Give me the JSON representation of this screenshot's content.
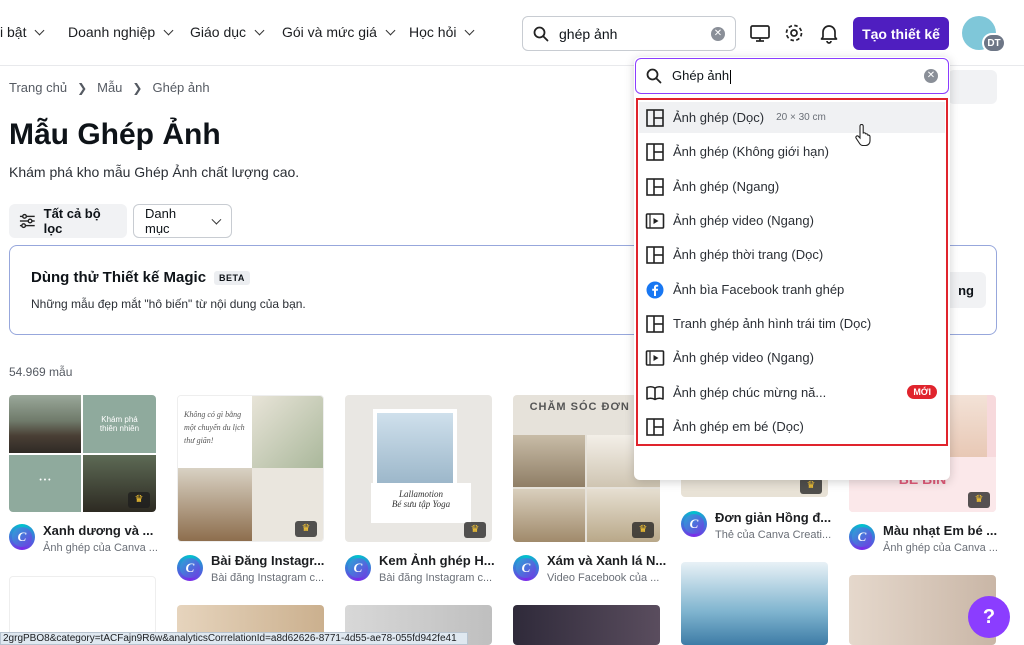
{
  "nav": {
    "items": [
      "i bật",
      "Doanh nghiệp",
      "Giáo dục",
      "Gói và mức giá",
      "Học hỏi"
    ],
    "search_value": "ghép ảnh",
    "create_label": "Tạo thiết kế",
    "avatar_initials": "DT"
  },
  "breadcrumb": [
    "Trang chủ",
    "Mẫu",
    "Ghép ảnh"
  ],
  "header": {
    "title": "Mẫu Ghép Ảnh",
    "subtitle": "Khám phá kho mẫu Ghép Ảnh chất lượng cao."
  },
  "filters": {
    "all_label": "Tất cả bộ lọc",
    "category_label": "Danh mục"
  },
  "magic": {
    "title": "Dùng thử Thiết kế Magic",
    "badge": "BETA",
    "desc": "Những mẫu đẹp mắt \"hô biến\" từ nội dung của bạn.",
    "button_partial": "ng"
  },
  "count": "54.969 mẫu",
  "cards": [
    {
      "title": "Xanh dương và ...",
      "sub": "Ảnh ghép của Canva ..."
    },
    {
      "title": "Bài Đăng Instagr...",
      "sub": "Bài đăng Instagram c..."
    },
    {
      "title": "Kem Ảnh ghép H...",
      "sub": "Bài đăng Instagram c..."
    },
    {
      "title": "Xám và Xanh lá N...",
      "sub": "Video Facebook của ..."
    },
    {
      "title": "Đơn giản Hồng đ...",
      "sub": "Thẻ của Canva Creati..."
    },
    {
      "title": "Màu nhạt Em bé ...",
      "sub": "Ảnh ghép của Canva ..."
    }
  ],
  "thumb_text": {
    "t1a": "Khám phá",
    "t1b": "thiên nhiên",
    "t2": "Không có gì bằng một chuyến du lịch thư giãn!",
    "t3a": "Lallamotion",
    "t3b": "Bé sưu tập Yoga",
    "t4": "CHĂM SÓC ĐƠN G",
    "t6": "BÉ BIN"
  },
  "dropdown": {
    "query": "Ghép ảnh",
    "items": [
      {
        "label": "Ảnh ghép (Dọc)",
        "meta": "20 × 30 cm",
        "icon": "layout-icon"
      },
      {
        "label": "Ảnh ghép (Không giới hạn)",
        "icon": "layout-icon"
      },
      {
        "label": "Ảnh ghép (Ngang)",
        "icon": "layout-icon"
      },
      {
        "label": "Ảnh ghép video (Ngang)",
        "icon": "video-icon"
      },
      {
        "label": "Ảnh ghép thời trang (Dọc)",
        "icon": "layout-icon"
      },
      {
        "label": "Ảnh bìa Facebook tranh ghép",
        "icon": "facebook-icon"
      },
      {
        "label": "Tranh ghép ảnh hình trái tim (Dọc)",
        "icon": "layout-icon"
      },
      {
        "label": "Ảnh ghép video (Ngang)",
        "icon": "video-icon"
      },
      {
        "label": "Ảnh ghép chúc mừng nă...",
        "icon": "book-icon",
        "badge": "MỚI"
      },
      {
        "label": "Ảnh ghép em bé (Dọc)",
        "icon": "layout-icon"
      }
    ]
  },
  "help_label": "?",
  "status_url": "2grgPBO8&category=tACFajn9R6w&analyticsCorrelationId=a8d62626-8771-4d55-ae78-055fd942fe41",
  "colors": {
    "accent": "#4f1ec0",
    "highlight": "#e0242d",
    "focus": "#8b3dff"
  }
}
